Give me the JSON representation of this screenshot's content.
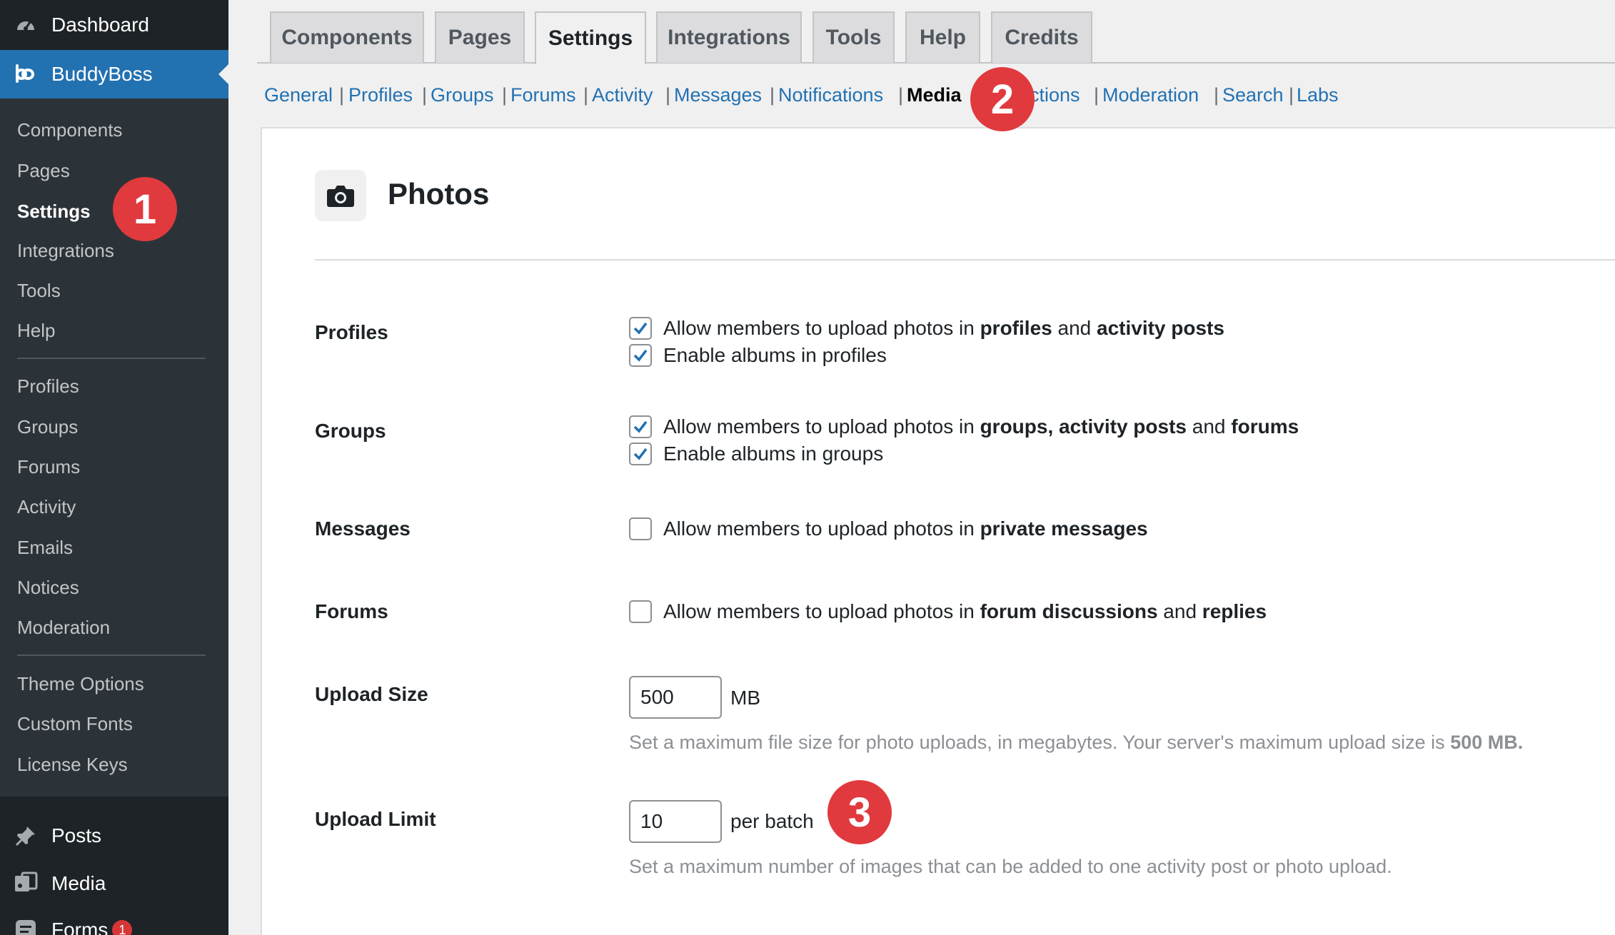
{
  "sidebar": {
    "top_items": [
      {
        "label": "Dashboard",
        "icon": "dashboard-icon"
      },
      {
        "label": "BuddyBoss",
        "icon": "buddyboss-icon"
      }
    ],
    "sub_items": [
      {
        "label": "Components"
      },
      {
        "label": "Pages"
      },
      {
        "label": "Settings"
      },
      {
        "label": "Integrations"
      },
      {
        "label": "Tools"
      },
      {
        "label": "Help"
      },
      {
        "label": "Profiles"
      },
      {
        "label": "Groups"
      },
      {
        "label": "Forums"
      },
      {
        "label": "Activity"
      },
      {
        "label": "Emails"
      },
      {
        "label": "Notices"
      },
      {
        "label": "Moderation"
      },
      {
        "label": "Theme Options"
      },
      {
        "label": "Custom Fonts"
      },
      {
        "label": "License Keys"
      }
    ],
    "active_sub": "Settings",
    "bottom_items": [
      {
        "label": "Posts",
        "icon": "pushpin-icon"
      },
      {
        "label": "Media",
        "icon": "media-icon"
      },
      {
        "label": "Forms",
        "icon": "forms-icon",
        "count": "1"
      }
    ]
  },
  "tabs": [
    {
      "label": "Components"
    },
    {
      "label": "Pages"
    },
    {
      "label": "Settings"
    },
    {
      "label": "Integrations"
    },
    {
      "label": "Tools"
    },
    {
      "label": "Help"
    },
    {
      "label": "Credits"
    }
  ],
  "active_tab": "Settings",
  "subnav": [
    {
      "label": "General"
    },
    {
      "label": "Profiles"
    },
    {
      "label": "Groups"
    },
    {
      "label": "Forums"
    },
    {
      "label": "Activity"
    },
    {
      "label": "Messages"
    },
    {
      "label": "Notifications"
    },
    {
      "label": "Media"
    },
    {
      "label": "ctions"
    },
    {
      "label": "Moderation"
    },
    {
      "label": "Search"
    },
    {
      "label": "Labs"
    }
  ],
  "active_subnav": "Media",
  "badges": [
    "1",
    "2",
    "3"
  ],
  "panel": {
    "title": "Photos",
    "icon": "camera-icon",
    "rows": {
      "profiles": {
        "label": "Profiles",
        "options": [
          {
            "checked": true,
            "parts": [
              "Allow members to upload photos in ",
              "profiles",
              " and ",
              "activity posts"
            ]
          },
          {
            "checked": true,
            "parts": [
              "Enable albums in profiles"
            ]
          }
        ]
      },
      "groups": {
        "label": "Groups",
        "options": [
          {
            "checked": true,
            "parts": [
              "Allow members to upload photos in ",
              "groups, activity posts",
              " and ",
              "forums"
            ]
          },
          {
            "checked": true,
            "parts": [
              "Enable albums in groups"
            ]
          }
        ]
      },
      "messages": {
        "label": "Messages",
        "options": [
          {
            "checked": false,
            "parts": [
              "Allow members to upload photos in ",
              "private messages"
            ]
          }
        ]
      },
      "forums": {
        "label": "Forums",
        "options": [
          {
            "checked": false,
            "parts": [
              "Allow members to upload photos in ",
              "forum discussions",
              " and ",
              "replies"
            ]
          }
        ]
      },
      "upload_size": {
        "label": "Upload Size",
        "value": "500",
        "unit": "MB",
        "help_prefix": "Set a maximum file size for photo uploads, in megabytes. Your server's maximum upload size is ",
        "help_bold": "500 MB."
      },
      "upload_limit": {
        "label": "Upload Limit",
        "value": "10",
        "unit": "per batch",
        "help": "Set a maximum number of images that can be added to one activity post or photo upload."
      }
    }
  },
  "colors": {
    "sidebar_bg": "#1d2327",
    "submenu_bg": "#2c3338",
    "accent": "#2271b1",
    "badge": "#e03a3e",
    "checkbox_check": "#2271b1"
  }
}
